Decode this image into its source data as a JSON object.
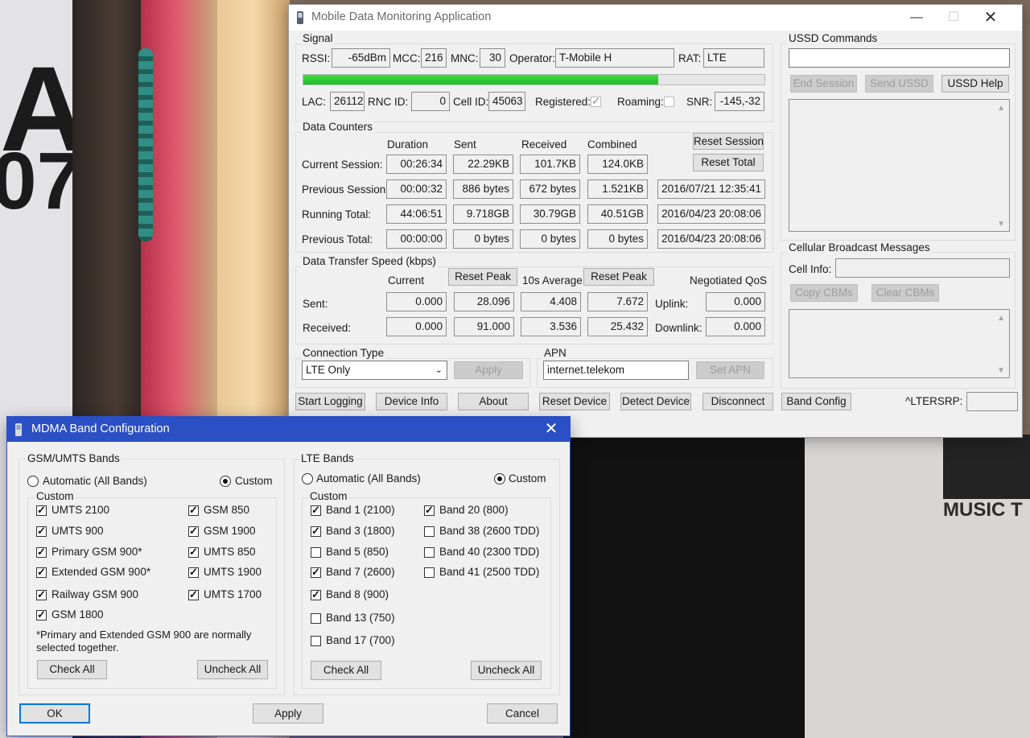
{
  "main": {
    "title": "Mobile Data Monitoring Application",
    "signal": {
      "group": "Signal",
      "rssi_label": "RSSI:",
      "rssi": "-65dBm",
      "mcc_label": "MCC:",
      "mcc": "216",
      "mnc_label": "MNC:",
      "mnc": "30",
      "operator_label": "Operator:",
      "operator": "T-Mobile H",
      "rat_label": "RAT:",
      "rat": "LTE",
      "signal_strength_fraction": 0.77,
      "lac_label": "LAC:",
      "lac": "26112",
      "rnc_label": "RNC ID:",
      "rnc": "0",
      "cellid_label": "Cell ID:",
      "cellid": "45063",
      "registered_label": "Registered:",
      "registered": true,
      "roaming_label": "Roaming:",
      "roaming": false,
      "snr_label": "SNR:",
      "snr": "-145,-32"
    },
    "counters": {
      "group": "Data Counters",
      "headers": [
        "Duration",
        "Sent",
        "Received",
        "Combined"
      ],
      "reset_session": "Reset Session",
      "reset_total": "Reset Total",
      "rows": [
        {
          "label": "Current Session:",
          "values": [
            "00:26:34",
            "22.29KB",
            "101.7KB",
            "124.0KB"
          ],
          "date": ""
        },
        {
          "label": "Previous Session:",
          "values": [
            "00:00:32",
            "886 bytes",
            "672 bytes",
            "1.521KB"
          ],
          "date": "2016/07/21 12:35:41"
        },
        {
          "label": "Running Total:",
          "values": [
            "44:06:51",
            "9.718GB",
            "30.79GB",
            "40.51GB"
          ],
          "date": "2016/04/23 20:08:06"
        },
        {
          "label": "Previous Total:",
          "values": [
            "00:00:00",
            "0 bytes",
            "0 bytes",
            "0 bytes"
          ],
          "date": "2016/04/23 20:08:06"
        }
      ]
    },
    "speed": {
      "group": "Data Transfer Speed (kbps)",
      "current_label": "Current",
      "reset_peak": "Reset Peak",
      "avg_label": "10s Average",
      "qos_label": "Negotiated QoS",
      "sent_label": "Sent:",
      "received_label": "Received:",
      "uplink_label": "Uplink:",
      "downlink_label": "Downlink:",
      "sent": [
        "0.000",
        "28.096",
        "4.408",
        "7.672"
      ],
      "received": [
        "0.000",
        "91.000",
        "3.536",
        "25.432"
      ],
      "uplink": "0.000",
      "downlink": "0.000"
    },
    "connection": {
      "group": "Connection Type",
      "value": "LTE Only",
      "apply": "Apply"
    },
    "apn": {
      "group": "APN",
      "value": "internet.telekom",
      "set": "Set APN"
    },
    "bottom_buttons": [
      "Start Logging",
      "Device Info",
      "About",
      "Reset Device",
      "Detect Device",
      "Disconnect",
      "Band Config"
    ],
    "ltersrp_label": "^LTERSRP:",
    "ussd": {
      "group": "USSD Commands",
      "end": "End Session",
      "send": "Send USSD",
      "help": "USSD Help"
    },
    "cbm": {
      "group": "Cellular Broadcast Messages",
      "cellinfo_label": "Cell Info:",
      "copy": "Copy CBMs",
      "clear": "Clear CBMs"
    }
  },
  "band": {
    "title": "MDMA Band Configuration",
    "gsm": {
      "group": "GSM/UMTS Bands",
      "auto_label": "Automatic (All Bands)",
      "custom_label": "Custom",
      "custom_group": "Custom",
      "left": [
        {
          "label": "UMTS 2100",
          "checked": true
        },
        {
          "label": "UMTS 900",
          "checked": true
        },
        {
          "label": "Primary GSM 900*",
          "checked": true
        },
        {
          "label": "Extended GSM 900*",
          "checked": true
        },
        {
          "label": "Railway GSM 900",
          "checked": true
        },
        {
          "label": "GSM 1800",
          "checked": true
        }
      ],
      "right": [
        {
          "label": "GSM 850",
          "checked": true
        },
        {
          "label": "GSM 1900",
          "checked": true
        },
        {
          "label": "UMTS 850",
          "checked": true
        },
        {
          "label": "UMTS 1900",
          "checked": true
        },
        {
          "label": "UMTS 1700",
          "checked": true
        }
      ],
      "note": "*Primary and Extended GSM 900 are normally selected together.",
      "check_all": "Check All",
      "uncheck_all": "Uncheck All"
    },
    "lte": {
      "group": "LTE Bands",
      "auto_label": "Automatic (All Bands)",
      "custom_label": "Custom",
      "custom_group": "Custom",
      "left": [
        {
          "label": "Band 1 (2100)",
          "checked": true
        },
        {
          "label": "Band 3 (1800)",
          "checked": true
        },
        {
          "label": "Band 5 (850)",
          "checked": false
        },
        {
          "label": "Band 7 (2600)",
          "checked": true
        },
        {
          "label": "Band 8 (900)",
          "checked": true
        },
        {
          "label": "Band 13 (750)",
          "checked": false
        },
        {
          "label": "Band 17 (700)",
          "checked": false
        }
      ],
      "right": [
        {
          "label": "Band 20 (800)",
          "checked": true
        },
        {
          "label": "Band 38 (2600 TDD)",
          "checked": false
        },
        {
          "label": "Band 40 (2300 TDD)",
          "checked": false
        },
        {
          "label": "Band 41 (2500 TDD)",
          "checked": false
        }
      ],
      "check_all": "Check All",
      "uncheck_all": "Uncheck All"
    },
    "ok": "OK",
    "apply": "Apply",
    "cancel": "Cancel"
  },
  "background": {
    "text_a": "A",
    "text_07": "07",
    "text_music": "MUSIC T"
  }
}
